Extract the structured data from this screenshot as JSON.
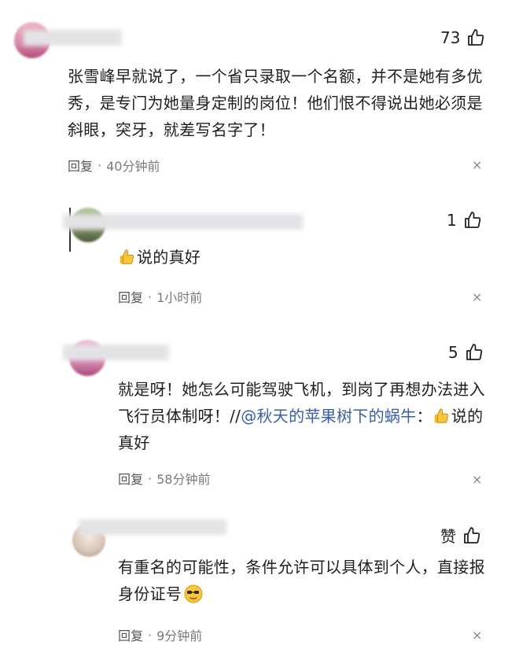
{
  "comments": [
    {
      "likes": "73",
      "text": "张雪峰早就说了，一个省只录取一个名额，并不是她有多优秀，是专门为她量身定制的岗位！他们恨不得说出她必须是斜眼，突牙，就差写名字了！",
      "reply_label": "回复",
      "separator": "·",
      "time": "40分钟前",
      "close": "×"
    },
    {
      "likes": "1",
      "text": "说的真好",
      "reply_label": "回复",
      "separator": "·",
      "time": "1小时前",
      "close": "×"
    },
    {
      "likes": "5",
      "text_before": "就是呀！她怎么可能驾驶飞机，到岗了再想办法进入飞行员体制呀！//",
      "mention": "@秋天的苹果树下的蜗牛",
      "text_after_mention": "：",
      "quote": "说的真好",
      "reply_label": "回复",
      "separator": "·",
      "time": "58分钟前",
      "close": "×"
    },
    {
      "likes": "赞",
      "text": "有重名的可能性，条件允许可以具体到个人，直接报身份证号",
      "reply_label": "回复",
      "separator": "·",
      "time": "9分钟前",
      "close": "×"
    }
  ],
  "icons": {
    "like": "thumbs-up-outline-icon",
    "thumb_emoji": "thumbs-up-emoji",
    "sunglasses_emoji": "smiling-face-sunglasses-emoji"
  },
  "colors": {
    "mention": "#3b5ea8",
    "meta": "#7a7a7a",
    "background": "#ffffff"
  }
}
